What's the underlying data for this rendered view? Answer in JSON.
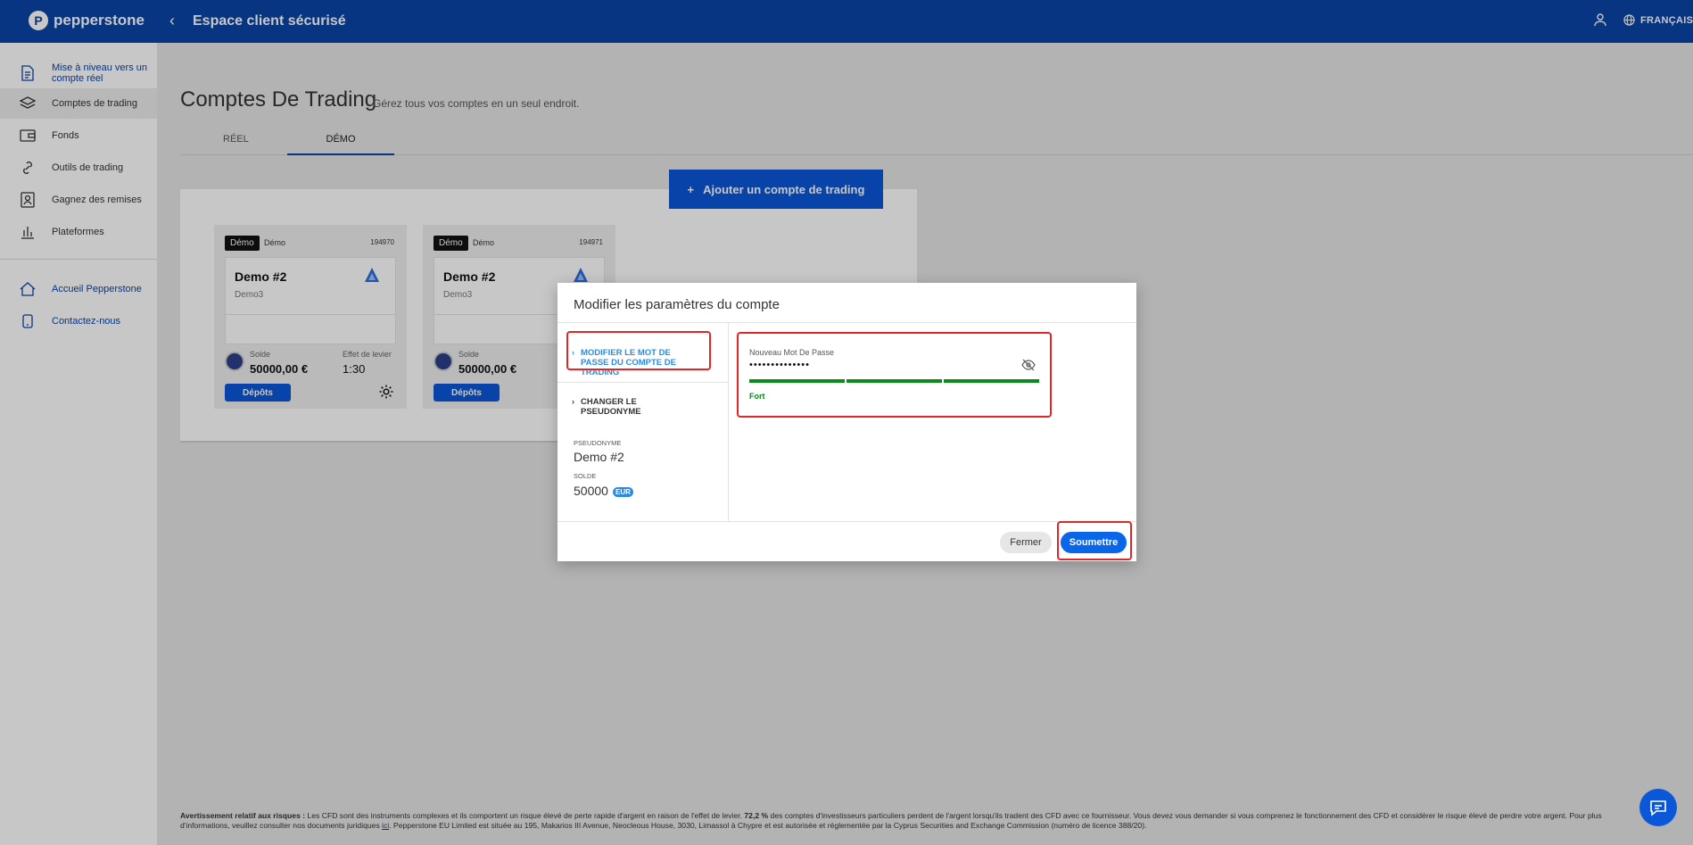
{
  "header": {
    "brand": "pepperstone",
    "title": "Espace client sécurisé",
    "language": "FRANÇAIS"
  },
  "sidebar": {
    "items": [
      {
        "label": "Mise à niveau vers un compte réel",
        "icon": "document-icon"
      },
      {
        "label": "Comptes de trading",
        "icon": "layers-icon"
      },
      {
        "label": "Fonds",
        "icon": "wallet-icon"
      },
      {
        "label": "Outils de trading",
        "icon": "link-icon"
      },
      {
        "label": "Gagnez des remises",
        "icon": "badge-icon"
      },
      {
        "label": "Plateformes",
        "icon": "bar-chart-icon"
      }
    ],
    "secondary": [
      {
        "label": "Accueil Pepperstone",
        "icon": "home-icon"
      },
      {
        "label": "Contactez-nous",
        "icon": "phone-icon"
      }
    ]
  },
  "main": {
    "title": "Comptes De Trading",
    "subtitle": "Gérez tous vos comptes en un seul endroit.",
    "tabs": [
      {
        "label": "RÉEL",
        "active": false
      },
      {
        "label": "DÉMO",
        "active": true
      }
    ],
    "add_button": "Ajouter un compte de trading",
    "accounts": [
      {
        "tag": "Démo",
        "type": "Démo",
        "number": "194970",
        "name": "Demo #2",
        "sub": "Demo3",
        "balance_label": "Solde",
        "balance": "50000,00 €",
        "leverage_label": "Effet de levier",
        "leverage": "1:30",
        "deposit": "Dépôts"
      },
      {
        "tag": "Démo",
        "type": "Démo",
        "number": "194971",
        "name": "Demo #2",
        "sub": "Demo3",
        "balance_label": "Solde",
        "balance": "50000,00 €",
        "deposit": "Dépôts"
      }
    ]
  },
  "modal": {
    "title": "Modifier les paramètres du compte",
    "menu": [
      {
        "label": "MODIFIER LE MOT DE PASSE DU COMPTE DE TRADING",
        "active": true
      },
      {
        "label": "CHANGER LE PSEUDONYME",
        "active": false
      }
    ],
    "pseudonym_label": "PSEUDONYME",
    "pseudonym": "Demo #2",
    "balance_label": "SOLDE",
    "balance": "50000",
    "currency": "EUR",
    "password_label": "Nouveau Mot De Passe",
    "password_value": "••••••••••••••",
    "strength": "Fort",
    "close_button": "Fermer",
    "submit_button": "Soumettre"
  },
  "disclaimer": {
    "title": "Avertissement relatif aux risques :",
    "part1": " Les CFD sont des instruments complexes et ils comportent un risque élevé de perte rapide d'argent en raison de l'effet de levier. ",
    "pct": "72,2 %",
    "part2": " des comptes d'investisseurs particuliers perdent de l'argent lorsqu'ils tradent des CFD avec ce fournisseur. Vous devez vous demander si vous comprenez le fonctionnement des CFD et considérer le risque élevé de perdre votre argent. Pour plus d'informations, veuillez consulter nos documents juridiques ",
    "link": "ici",
    "part3": ". Pepperstone EU Limited est située au 195, Makarios III Avenue, Neocleous House, 3030, Limassol à Chypre et est autorisée et réglementée par la Cyprus Securities and Exchange Commission (numéro de licence 388/20)."
  },
  "colors": {
    "brand": "#0a44a6",
    "button": "#0a57d8",
    "strength": "#0b8a1e",
    "highlight": "#e02626"
  }
}
